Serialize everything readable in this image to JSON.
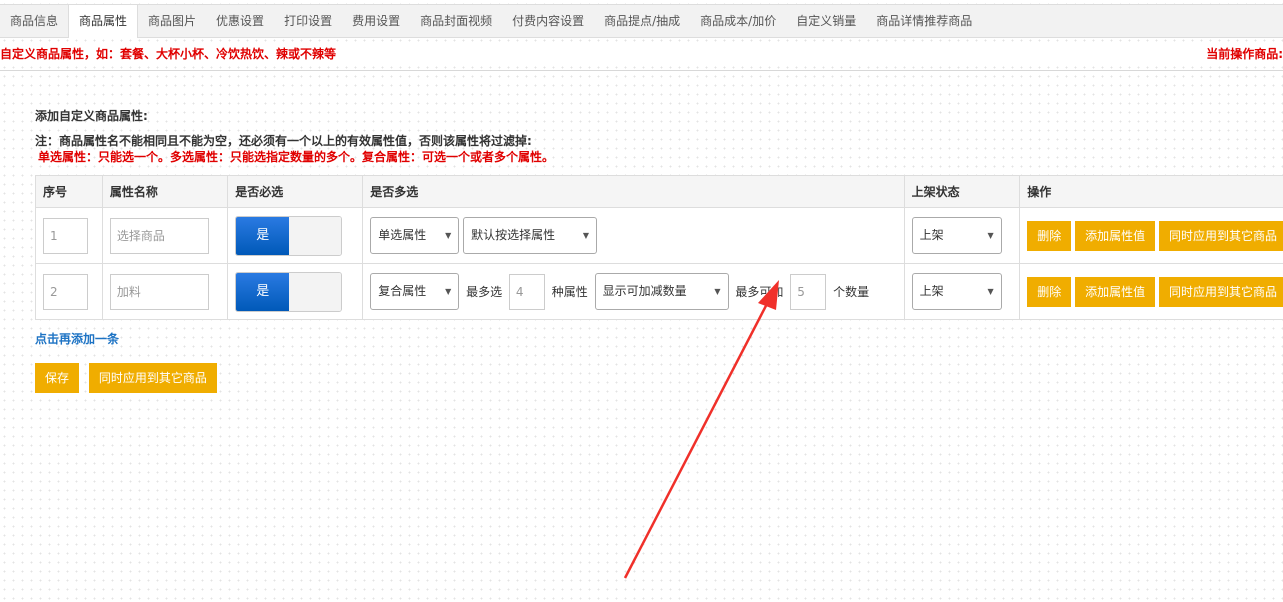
{
  "tabs": [
    "商品信息",
    "商品属性",
    "商品图片",
    "优惠设置",
    "打印设置",
    "费用设置",
    "商品封面视频",
    "付费内容设置",
    "商品提点/抽成",
    "商品成本/加价",
    "自定义销量",
    "商品详情推荐商品"
  ],
  "active_tab": "商品属性",
  "notice": {
    "left": "自定义商品属性，如：套餐、大杯小杯、冷饮热饮、辣或不辣等",
    "right": "当前操作商品:"
  },
  "section_title": "添加自定义商品属性:",
  "note_line1": "注：商品属性名不能相同且不能为空，还必须有一个以上的有效属性值，否则该属性将过滤掉:",
  "note_line2": "单选属性：只能选一个。多选属性：只能选指定数量的多个。复合属性：可选一个或者多个属性。",
  "table": {
    "headers": [
      "序号",
      "属性名称",
      "是否必选",
      "是否多选",
      "上架状态",
      "操作"
    ],
    "rows": [
      {
        "index": "1",
        "name_placeholder": "选择商品",
        "required": "是",
        "type": "单选属性",
        "mode": "默认按选择属性",
        "status": "上架",
        "delete": "删除",
        "add_value": "添加属性值",
        "apply_other": "同时应用到其它商品"
      },
      {
        "index": "2",
        "name_placeholder": "加料",
        "required": "是",
        "type": "复合属性",
        "max_label": "最多选",
        "max_value": "4",
        "max_unit": "种属性",
        "mode": "显示可加减数量",
        "max_add_label": "最多可加",
        "max_add_value": "5",
        "max_add_unit": "个数量",
        "status": "上架",
        "delete": "删除",
        "add_value": "添加属性值",
        "apply_other": "同时应用到其它商品"
      }
    ]
  },
  "add_link": "点击再添加一条",
  "save_button": "保存",
  "apply_all_button": "同时应用到其它商品",
  "colors": {
    "accent_button": "#f0ad00",
    "warning_text": "#e00000",
    "toggle_on": "#0059b8",
    "link": "#1d73c4",
    "annotation_arrow": "#f0302a"
  }
}
